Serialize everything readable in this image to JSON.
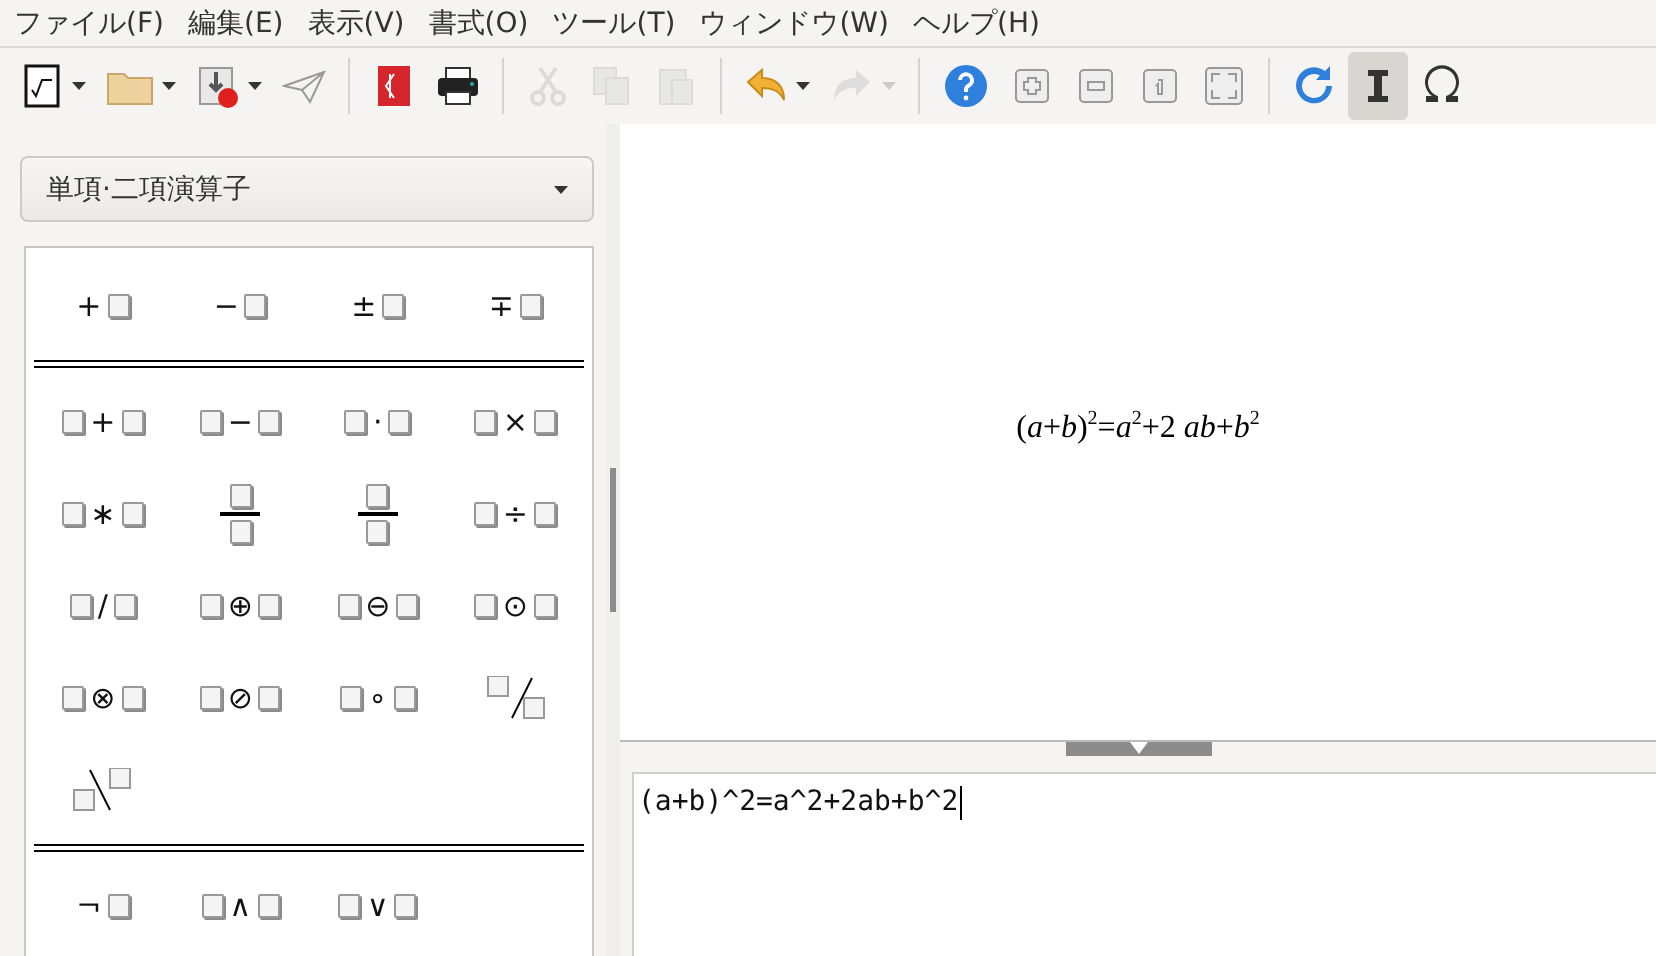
{
  "menu": [
    "ファイル(F)",
    "編集(E)",
    "表示(V)",
    "書式(O)",
    "ツール(T)",
    "ウィンドウ(W)",
    "ヘルプ(H)"
  ],
  "toolbar": [
    {
      "kind": "new",
      "dropdown": true,
      "disabled": false,
      "selected": false
    },
    {
      "kind": "open",
      "dropdown": true,
      "disabled": false,
      "selected": false
    },
    {
      "kind": "save",
      "dropdown": true,
      "disabled": false,
      "selected": false
    },
    {
      "kind": "send",
      "dropdown": false,
      "disabled": false,
      "selected": false
    },
    {
      "kind": "separator"
    },
    {
      "kind": "pdf",
      "dropdown": false,
      "disabled": false,
      "selected": false
    },
    {
      "kind": "print",
      "dropdown": false,
      "disabled": false,
      "selected": false
    },
    {
      "kind": "separator"
    },
    {
      "kind": "cut",
      "dropdown": false,
      "disabled": true,
      "selected": false
    },
    {
      "kind": "copy",
      "dropdown": false,
      "disabled": true,
      "selected": false
    },
    {
      "kind": "paste",
      "dropdown": false,
      "disabled": true,
      "selected": false
    },
    {
      "kind": "separator"
    },
    {
      "kind": "undo",
      "dropdown": true,
      "disabled": false,
      "selected": false
    },
    {
      "kind": "redo",
      "dropdown": true,
      "disabled": true,
      "selected": false
    },
    {
      "kind": "separator"
    },
    {
      "kind": "help",
      "dropdown": false,
      "disabled": false,
      "selected": false
    },
    {
      "kind": "zoom_in",
      "dropdown": false,
      "disabled": false,
      "selected": false
    },
    {
      "kind": "zoom_out",
      "dropdown": false,
      "disabled": false,
      "selected": false
    },
    {
      "kind": "zoom_100",
      "dropdown": false,
      "disabled": false,
      "selected": false
    },
    {
      "kind": "zoom_fit",
      "dropdown": false,
      "disabled": false,
      "selected": false
    },
    {
      "kind": "separator"
    },
    {
      "kind": "update",
      "dropdown": false,
      "disabled": false,
      "selected": false
    },
    {
      "kind": "cursor",
      "dropdown": false,
      "disabled": false,
      "selected": true
    },
    {
      "kind": "symbols",
      "dropdown": false,
      "disabled": false,
      "selected": false
    }
  ],
  "elements": {
    "category": "単項·二項演算子",
    "groups": [
      [
        {
          "kind": "prefix",
          "op": "+"
        },
        {
          "kind": "prefix",
          "op": "−"
        },
        {
          "kind": "prefix",
          "op": "±"
        },
        {
          "kind": "prefix",
          "op": "∓"
        }
      ],
      [
        {
          "kind": "infix",
          "op": "+"
        },
        {
          "kind": "infix",
          "op": "−"
        },
        {
          "kind": "infix",
          "op": "·"
        },
        {
          "kind": "infix",
          "op": "×"
        },
        {
          "kind": "infix",
          "op": "∗"
        },
        {
          "kind": "fraction"
        },
        {
          "kind": "fraction"
        },
        {
          "kind": "infix",
          "op": "÷"
        },
        {
          "kind": "infix",
          "op": "/"
        },
        {
          "kind": "infix",
          "op": "⊕"
        },
        {
          "kind": "infix",
          "op": "⊖"
        },
        {
          "kind": "infix",
          "op": "⊙"
        },
        {
          "kind": "infix",
          "op": "⊗"
        },
        {
          "kind": "infix",
          "op": "⊘"
        },
        {
          "kind": "infix",
          "op": "∘"
        },
        {
          "kind": "wideslash"
        },
        {
          "kind": "widebslash"
        }
      ],
      [
        {
          "kind": "prefix",
          "op": "¬"
        },
        {
          "kind": "infix",
          "op": "∧"
        },
        {
          "kind": "infix",
          "op": "∨"
        }
      ]
    ]
  },
  "preview": {
    "formula": "(*a*+*b*)$^{2}$=*a*$^{2}$+2 *ab*+*b*$^{2}$"
  },
  "command": {
    "value": "(a+b)^2=a^2+2ab+b^2"
  }
}
